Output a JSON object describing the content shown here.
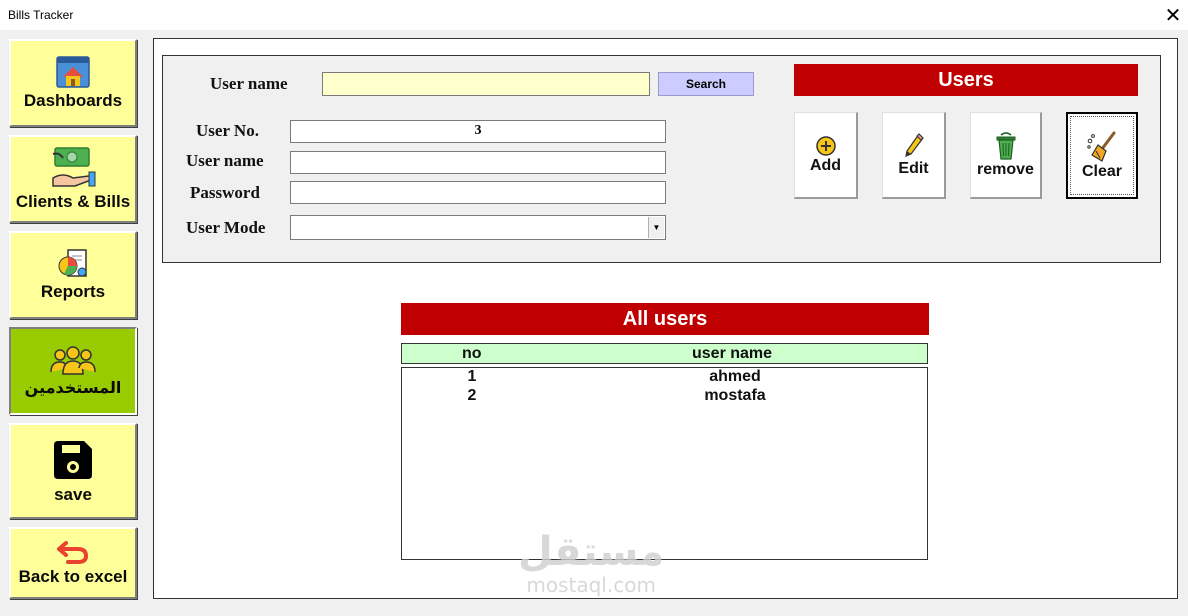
{
  "window": {
    "title": "Bills Tracker",
    "close_glyph": "✕"
  },
  "sidebar": {
    "items": [
      {
        "label": "Dashboards",
        "icon": "home-window-icon"
      },
      {
        "label": "Clients & Bills",
        "icon": "money-hand-icon"
      },
      {
        "label": "Reports",
        "icon": "pie-report-icon"
      },
      {
        "label": "المستخدمين",
        "icon": "users-group-icon",
        "active": true
      },
      {
        "label": "save",
        "icon": "floppy-disk-icon"
      },
      {
        "label": "Back to excel",
        "icon": "undo-arrow-icon"
      }
    ]
  },
  "search": {
    "label": "User name",
    "value": "",
    "button": "Search"
  },
  "form": {
    "user_no_label": "User No.",
    "user_no_value": "3",
    "user_name_label": "User name",
    "user_name_value": "",
    "password_label": "Password",
    "password_value": "",
    "user_mode_label": "User Mode",
    "user_mode_value": ""
  },
  "users_banner": "Users",
  "actions": {
    "add": "Add",
    "edit": "Edit",
    "remove": "remove",
    "clear": "Clear"
  },
  "all_users": {
    "title": "All users",
    "columns": [
      "no",
      "user name"
    ],
    "rows": [
      {
        "no": "1",
        "name": "ahmed"
      },
      {
        "no": "2",
        "name": "mostafa"
      }
    ]
  },
  "watermark": {
    "arabic": "مستقل",
    "latin": "mostaql.com"
  },
  "colors": {
    "nav_bg": "#ffff99",
    "nav_active": "#99cc00",
    "banner": "#c00000",
    "search_btn": "#ccccff",
    "list_header": "#ccffcc",
    "search_field": "#ffffcc"
  }
}
